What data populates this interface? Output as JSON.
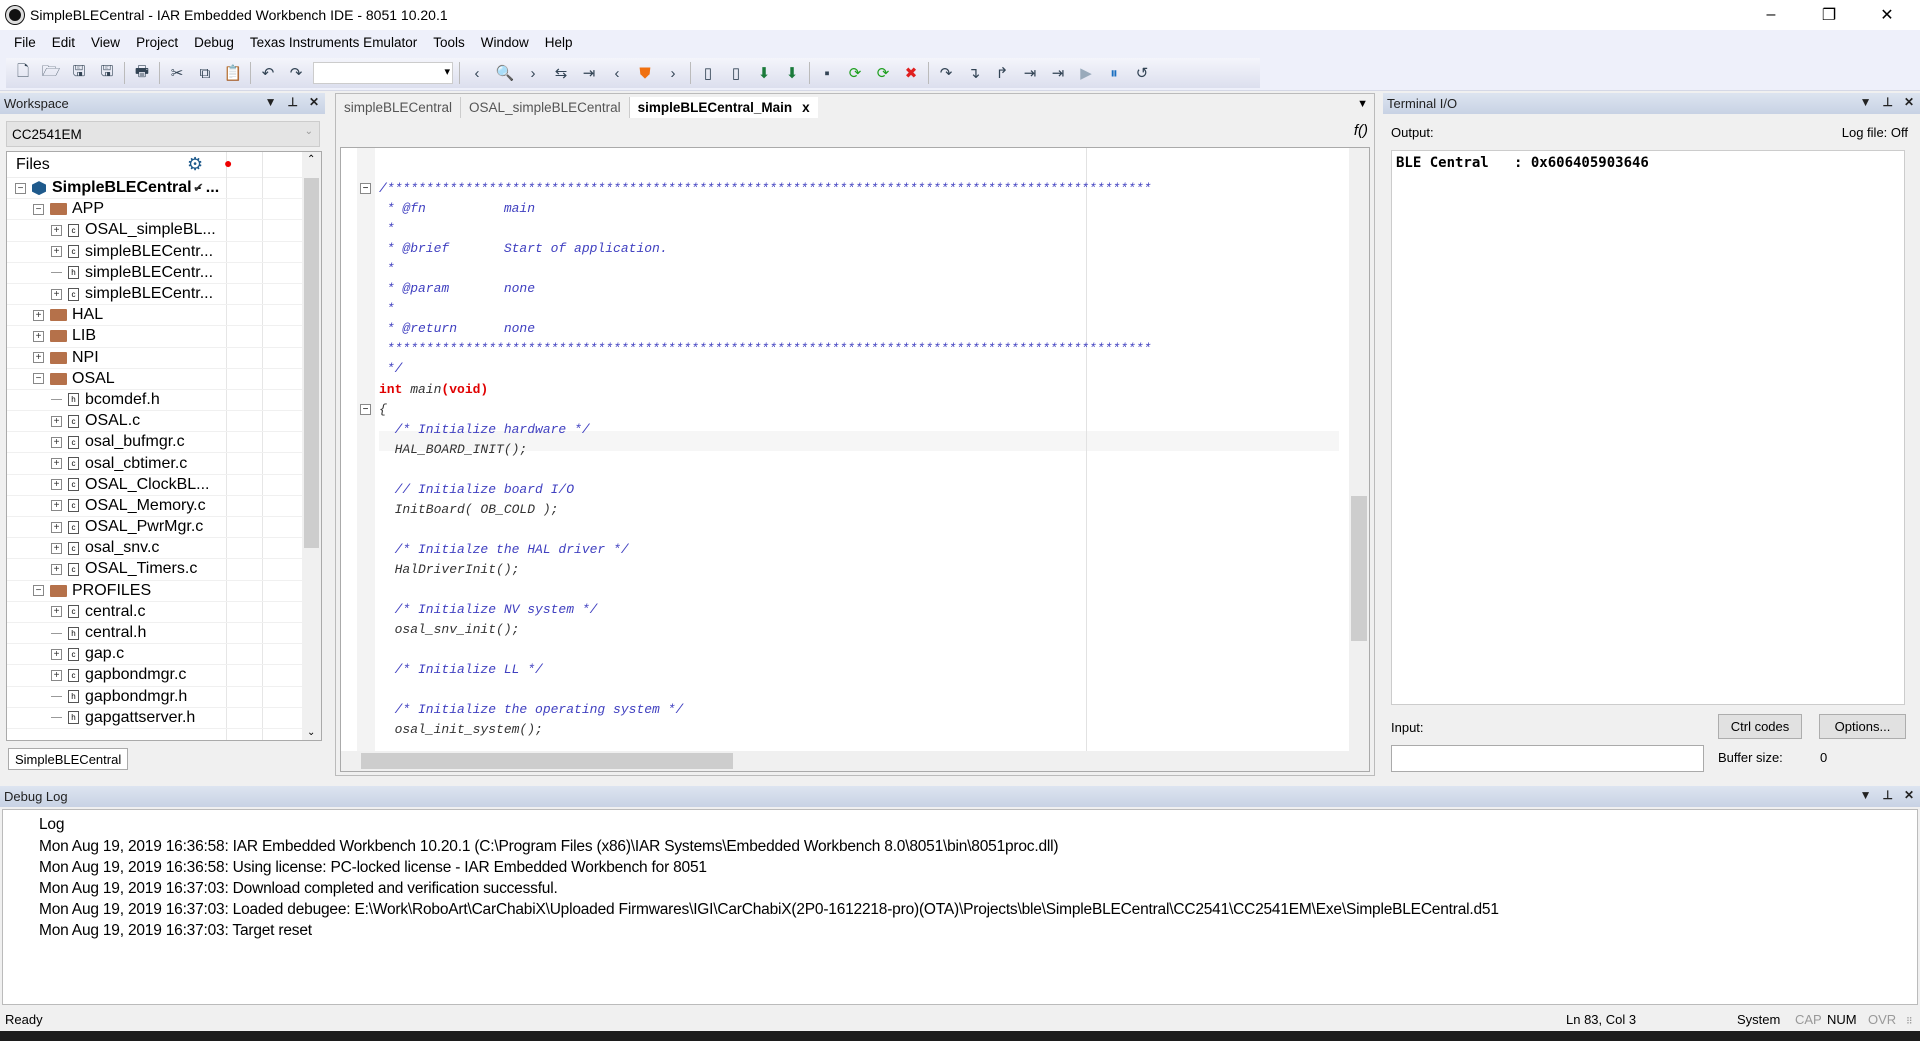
{
  "window": {
    "title": "SimpleBLECentral - IAR Embedded Workbench IDE - 8051 10.20.1",
    "minimize": "–",
    "maximize": "❐",
    "close": "✕"
  },
  "menu": [
    "File",
    "Edit",
    "View",
    "Project",
    "Debug",
    "Texas Instruments Emulator",
    "Tools",
    "Window",
    "Help"
  ],
  "toolbar": {
    "icons": [
      "new-file-icon",
      "open-icon",
      "save-icon",
      "save-all-icon",
      "print-icon",
      "cut-icon",
      "copy-icon",
      "paste-icon",
      "undo-icon",
      "redo-icon",
      "find-combo",
      "back-icon",
      "find-icon",
      "forward-icon",
      "replace-icon",
      "goto-icon",
      "prev-bookmark-icon",
      "toggle-bookmark-icon",
      "next-bookmark-icon",
      "compile-icon",
      "make-icon",
      "download-debug-icon",
      "debug-without-download-icon",
      "stop-build-icon",
      "reset-icon",
      "restart-icon",
      "stop-debug-icon",
      "step-over-icon",
      "step-into-icon",
      "step-out-icon",
      "next-statement-icon",
      "run-to-cursor-icon",
      "go-icon",
      "break-icon",
      "reset-debug-icon"
    ]
  },
  "workspace": {
    "title": "Workspace",
    "configuration": "CC2541EM",
    "files_header": "Files",
    "bottom_tab": "SimpleBLECentral",
    "tree": [
      {
        "label": "SimpleBLECentral - ...",
        "type": "project",
        "depth": 0,
        "expander": "minus",
        "checked": true
      },
      {
        "label": "APP",
        "type": "folder",
        "depth": 1,
        "expander": "minus"
      },
      {
        "label": "OSAL_simpleBL...",
        "type": "c",
        "depth": 2,
        "expander": "plus"
      },
      {
        "label": "simpleBLECentr...",
        "type": "c",
        "depth": 2,
        "expander": "plus"
      },
      {
        "label": "simpleBLECentr...",
        "type": "h",
        "depth": 2,
        "expander": "none"
      },
      {
        "label": "simpleBLECentr...",
        "type": "c",
        "depth": 2,
        "expander": "plus"
      },
      {
        "label": "HAL",
        "type": "folder",
        "depth": 1,
        "expander": "plus"
      },
      {
        "label": "LIB",
        "type": "folder",
        "depth": 1,
        "expander": "plus"
      },
      {
        "label": "NPI",
        "type": "folder",
        "depth": 1,
        "expander": "plus"
      },
      {
        "label": "OSAL",
        "type": "folder",
        "depth": 1,
        "expander": "minus"
      },
      {
        "label": "bcomdef.h",
        "type": "h",
        "depth": 2,
        "expander": "none"
      },
      {
        "label": "OSAL.c",
        "type": "c",
        "depth": 2,
        "expander": "plus"
      },
      {
        "label": "osal_bufmgr.c",
        "type": "c",
        "depth": 2,
        "expander": "plus"
      },
      {
        "label": "osal_cbtimer.c",
        "type": "c",
        "depth": 2,
        "expander": "plus"
      },
      {
        "label": "OSAL_ClockBL...",
        "type": "c",
        "depth": 2,
        "expander": "plus"
      },
      {
        "label": "OSAL_Memory.c",
        "type": "c",
        "depth": 2,
        "expander": "plus"
      },
      {
        "label": "OSAL_PwrMgr.c",
        "type": "c",
        "depth": 2,
        "expander": "plus"
      },
      {
        "label": "osal_snv.c",
        "type": "c",
        "depth": 2,
        "expander": "plus"
      },
      {
        "label": "OSAL_Timers.c",
        "type": "c",
        "depth": 2,
        "expander": "plus"
      },
      {
        "label": "PROFILES",
        "type": "folder",
        "depth": 1,
        "expander": "minus"
      },
      {
        "label": "central.c",
        "type": "c",
        "depth": 2,
        "expander": "plus"
      },
      {
        "label": "central.h",
        "type": "h",
        "depth": 2,
        "expander": "none"
      },
      {
        "label": "gap.c",
        "type": "c",
        "depth": 2,
        "expander": "plus"
      },
      {
        "label": "gapbondmgr.c",
        "type": "c",
        "depth": 2,
        "expander": "plus"
      },
      {
        "label": "gapbondmgr.h",
        "type": "h",
        "depth": 2,
        "expander": "none"
      },
      {
        "label": "gapgattserver.h",
        "type": "h",
        "depth": 2,
        "expander": "none"
      }
    ]
  },
  "editor": {
    "tabs": [
      {
        "label": "simpleBLECentral",
        "active": false
      },
      {
        "label": "OSAL_simpleBLECentral",
        "active": false
      },
      {
        "label": "simpleBLECentral_Main",
        "active": true
      }
    ],
    "close_tab": "x",
    "func_button": "f()",
    "lines": [
      {
        "text": "",
        "kind": "plain"
      },
      {
        "text": "/**************************************************************************************************",
        "kind": "com"
      },
      {
        "text": " * @fn          main",
        "kind": "com"
      },
      {
        "text": " *",
        "kind": "com"
      },
      {
        "text": " * @brief       Start of application.",
        "kind": "com"
      },
      {
        "text": " *",
        "kind": "com"
      },
      {
        "text": " * @param       none",
        "kind": "com"
      },
      {
        "text": " *",
        "kind": "com"
      },
      {
        "text": " * @return      none",
        "kind": "com"
      },
      {
        "text": " **************************************************************************************************",
        "kind": "com"
      },
      {
        "text": " */",
        "kind": "com"
      },
      {
        "text": "int main(void)",
        "kind": "sig"
      },
      {
        "text": "{",
        "kind": "plain"
      },
      {
        "text": "  /* Initialize hardware */",
        "kind": "com"
      },
      {
        "text": "  HAL_BOARD_INIT();",
        "kind": "plain"
      },
      {
        "text": "",
        "kind": "plain"
      },
      {
        "text": "  // Initialize board I/O",
        "kind": "com"
      },
      {
        "text": "  InitBoard( OB_COLD );",
        "kind": "plain"
      },
      {
        "text": "",
        "kind": "plain"
      },
      {
        "text": "  /* Initialze the HAL driver */",
        "kind": "com"
      },
      {
        "text": "  HalDriverInit();",
        "kind": "plain"
      },
      {
        "text": "",
        "kind": "plain"
      },
      {
        "text": "  /* Initialize NV system */",
        "kind": "com"
      },
      {
        "text": "  osal_snv_init();",
        "kind": "plain"
      },
      {
        "text": "",
        "kind": "plain"
      },
      {
        "text": "  /* Initialize LL */",
        "kind": "com"
      },
      {
        "text": "",
        "kind": "plain"
      },
      {
        "text": "  /* Initialize the operating system */",
        "kind": "com"
      },
      {
        "text": "  osal_init_system();",
        "kind": "plain"
      }
    ]
  },
  "terminal": {
    "title": "Terminal I/O",
    "output_label": "Output:",
    "log_file": "Log file: Off",
    "output_text": "BLE Central   : 0x606405903646",
    "input_label": "Input:",
    "input_value": "",
    "ctrl_codes": "Ctrl codes",
    "options": "Options...",
    "buffer_label": "Buffer size:",
    "buffer_value": "0"
  },
  "debug_log": {
    "title": "Debug Log",
    "column": "Log",
    "lines": [
      "Mon Aug 19, 2019 16:36:58: IAR Embedded Workbench 10.20.1 (C:\\Program Files (x86)\\IAR Systems\\Embedded Workbench 8.0\\8051\\bin\\8051proc.dll)",
      "Mon Aug 19, 2019 16:36:58: Using license: PC-locked license - IAR Embedded Workbench for 8051",
      "Mon Aug 19, 2019 16:37:03: Download completed and verification successful.",
      "Mon Aug 19, 2019 16:37:03: Loaded debugee: E:\\Work\\RoboArt\\CarChabiX\\Uploaded Firmwares\\IGI\\CarChabiX(2P0-1612218-pro)(OTA)\\Projects\\ble\\SimpleBLECentral\\CC2541\\CC2541EM\\Exe\\SimpleBLECentral.d51",
      "Mon Aug 19, 2019 16:37:03: Target reset"
    ]
  },
  "status": {
    "left": "Ready",
    "position": "Ln 83, Col 3",
    "encoding": "System",
    "cap": "CAP",
    "num": "NUM",
    "ovr": "OVR"
  }
}
